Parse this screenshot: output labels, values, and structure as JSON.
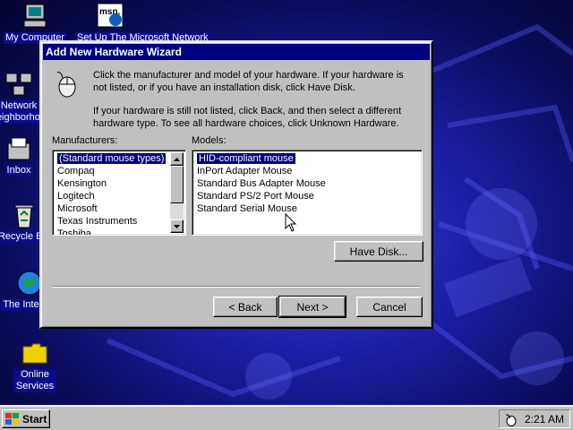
{
  "desktop": {
    "icons": [
      {
        "label": "My Computer",
        "icon": "computer-icon"
      },
      {
        "label": "Network Neighborhood",
        "icon": "network-icon"
      },
      {
        "label": "Inbox",
        "icon": "inbox-icon"
      },
      {
        "label": "Recycle Bin",
        "icon": "recycle-bin-icon"
      },
      {
        "label": "The Internet",
        "icon": "internet-icon"
      },
      {
        "label": "Online Services",
        "icon": "folder-icon"
      },
      {
        "label": "Set Up The Microsoft Network",
        "icon": "msn-icon",
        "logo_text": "msn."
      }
    ]
  },
  "window": {
    "title": "Add New Hardware Wizard",
    "intro_text": "Click the manufacturer and model of your hardware. If your hardware is not listed, or if you have an installation disk, click Have Disk.",
    "help_text": "If your hardware is still not listed, click Back, and then select a different hardware type. To see all hardware choices, click Unknown Hardware.",
    "manufacturers_label": "Manufacturers:",
    "models_label": "Models:",
    "manufacturers": [
      "(Standard mouse types)",
      "Compaq",
      "Kensington",
      "Logitech",
      "Microsoft",
      "Texas Instruments",
      "Toshiba"
    ],
    "selected_manufacturer": "(Standard mouse types)",
    "models": [
      "HID-compliant mouse",
      "InPort Adapter Mouse",
      "Standard Bus Adapter Mouse",
      "Standard PS/2 Port Mouse",
      "Standard Serial Mouse"
    ],
    "selected_model": "HID-compliant mouse",
    "have_disk_label": "Have Disk...",
    "back_label": "< Back",
    "next_label": "Next >",
    "cancel_label": "Cancel"
  },
  "taskbar": {
    "start_label": "Start",
    "clock": "2:21 AM"
  }
}
